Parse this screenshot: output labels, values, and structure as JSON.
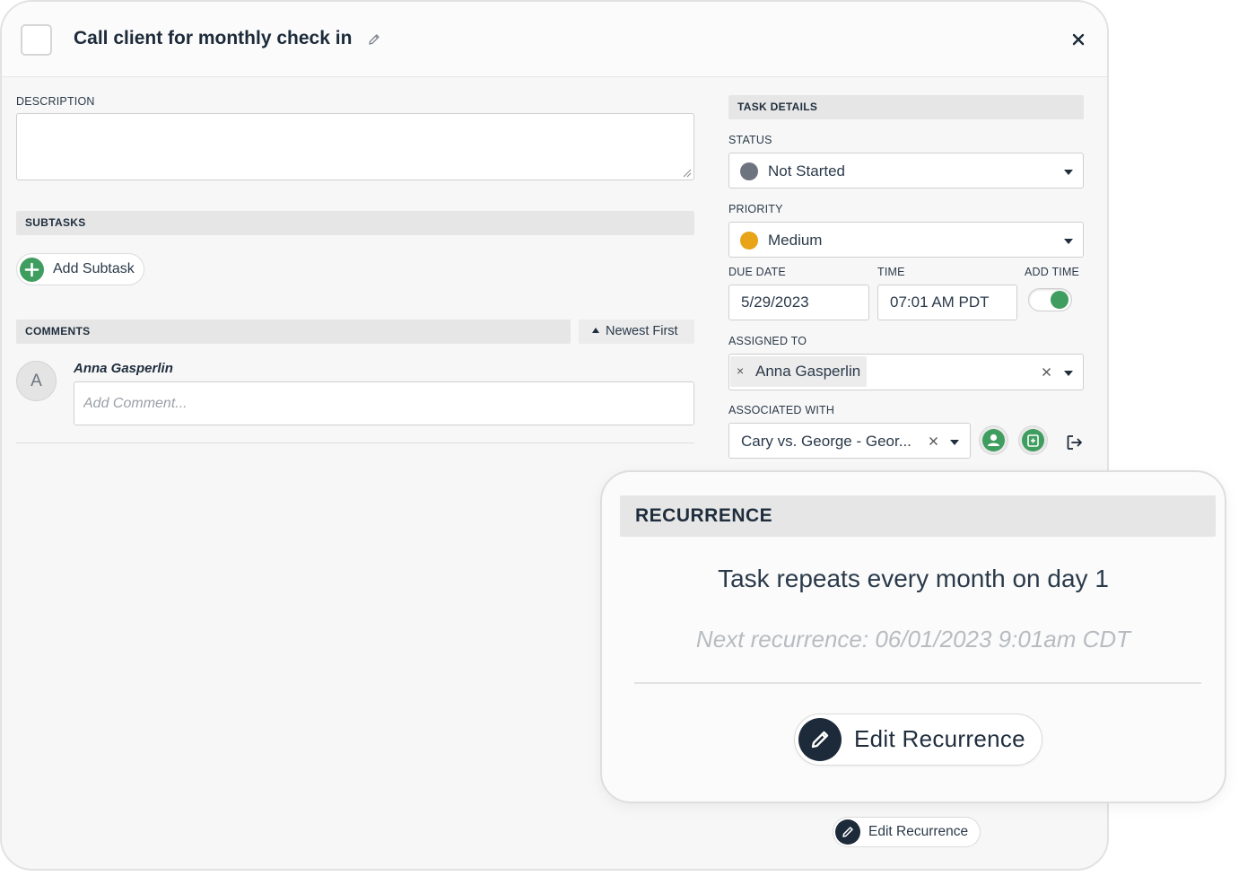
{
  "task": {
    "title": "Call client for monthly check in"
  },
  "left": {
    "description_label": "DESCRIPTION",
    "description_value": "",
    "subtasks_label": "SUBTASKS",
    "add_subtask_label": "Add Subtask",
    "comments_label": "COMMENTS",
    "sort_label": "Newest First",
    "comment_author": "Anna Gasperlin",
    "comment_avatar_initial": "A",
    "comment_placeholder": "Add Comment..."
  },
  "details": {
    "header": "TASK DETAILS",
    "status_label": "STATUS",
    "status_value": "Not Started",
    "status_color": "#6e7380",
    "priority_label": "PRIORITY",
    "priority_value": "Medium",
    "priority_color": "#e8a317",
    "due_date_label": "DUE DATE",
    "due_date_value": "5/29/2023",
    "time_label": "TIME",
    "time_value": "07:01 AM PDT",
    "add_time_label": "ADD TIME",
    "add_time_enabled": true,
    "assigned_label": "ASSIGNED TO",
    "assigned_value": "Anna Gasperlin",
    "associated_label": "ASSOCIATED WITH",
    "associated_value": "Cary vs. George - Geor..."
  },
  "recurrence": {
    "header": "RECURRENCE",
    "summary": "Task repeats every month on day 1",
    "next": "Next recurrence: 06/01/2023 9:01am CDT",
    "edit_label": "Edit Recurrence"
  },
  "footer": {
    "edit_recurrence_label": "Edit Recurrence"
  },
  "colors": {
    "accent_green": "#3f9d5f",
    "dark_navy": "#1c2a3a"
  }
}
